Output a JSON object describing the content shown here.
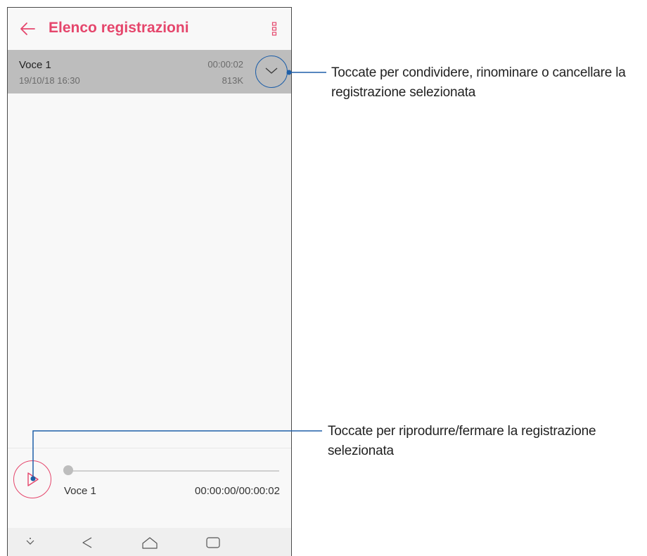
{
  "app": {
    "title": "Elenco registrazioni",
    "accent_color": "#e5466c",
    "back_icon": "arrow-left-icon",
    "menu_icon": "more-vertical-icon"
  },
  "recording_list": [
    {
      "name": "Voce 1",
      "date": "19/10/18 16:30",
      "duration": "00:00:02",
      "size": "813K",
      "selected": true,
      "expand_icon": "chevron-down-icon"
    }
  ],
  "player": {
    "track_name": "Voce 1",
    "time": "00:00:00/00:00:02",
    "progress": 0,
    "play_icon": "play-icon"
  },
  "navbar": {
    "icons": [
      "hide-nav-icon",
      "back-triangle-icon",
      "home-icon",
      "recent-apps-icon"
    ]
  },
  "callouts": {
    "expand_line1": "Toccate per condividere, rinominare o cancellare la",
    "expand_line2": "registrazione selezionata",
    "play_line1": "Toccate per riprodurre/fermare la registrazione",
    "play_line2": "selezionata",
    "line_color": "#1e5fa8"
  }
}
